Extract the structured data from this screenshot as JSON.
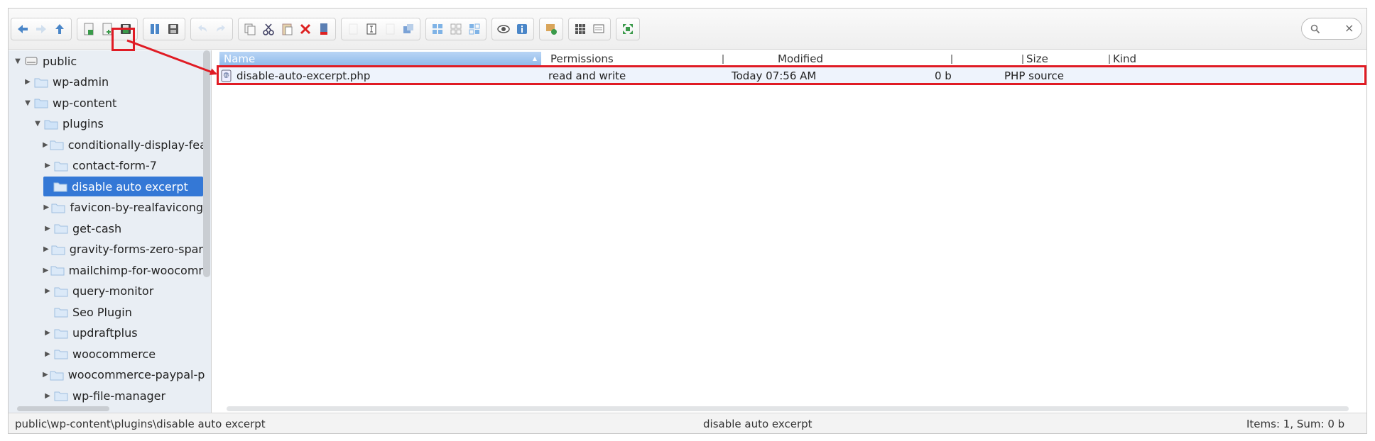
{
  "toolbar": {
    "groups": [
      {
        "buttons": [
          "back-icon",
          "forward-icon",
          "up-icon"
        ]
      },
      {
        "buttons": [
          "new-folder-icon",
          "new-file-icon",
          "save-icon"
        ]
      },
      {
        "buttons": [
          "open-icon",
          "download-icon"
        ]
      },
      {
        "buttons": [
          "undo-icon",
          "redo-icon"
        ]
      },
      {
        "buttons": [
          "copy-icon",
          "cut-icon",
          "paste-icon",
          "delete-icon",
          "empty-icon"
        ]
      },
      {
        "buttons": [
          "duplicate-icon",
          "rename-icon",
          "edit-icon",
          "resize-icon"
        ]
      },
      {
        "buttons": [
          "select-all-icon",
          "select-none-icon",
          "invert-icon"
        ]
      },
      {
        "buttons": [
          "preview-icon",
          "info-icon"
        ]
      },
      {
        "buttons": [
          "extract-icon"
        ]
      },
      {
        "buttons": [
          "icons-view-icon",
          "list-view-icon"
        ]
      },
      {
        "buttons": [
          "fullscreen-icon"
        ]
      }
    ],
    "search_clear": "×"
  },
  "tree": {
    "items": [
      {
        "label": "public",
        "level": 0,
        "expanded": true,
        "type": "drive"
      },
      {
        "label": "wp-admin",
        "level": 1,
        "expanded": false
      },
      {
        "label": "wp-content",
        "level": 1,
        "expanded": true
      },
      {
        "label": "plugins",
        "level": 2,
        "expanded": true
      },
      {
        "label": "conditionally-display-fea",
        "level": 3,
        "expanded": false
      },
      {
        "label": "contact-form-7",
        "level": 3,
        "expanded": false
      },
      {
        "label": "disable auto excerpt",
        "level": 3,
        "selected": true
      },
      {
        "label": "favicon-by-realfavicong",
        "level": 3,
        "expanded": false
      },
      {
        "label": "get-cash",
        "level": 3,
        "expanded": false
      },
      {
        "label": "gravity-forms-zero-spar",
        "level": 3,
        "expanded": false
      },
      {
        "label": "mailchimp-for-woocomr",
        "level": 3,
        "expanded": false
      },
      {
        "label": "query-monitor",
        "level": 3,
        "expanded": false
      },
      {
        "label": "Seo Plugin",
        "level": 3,
        "noarrow": true
      },
      {
        "label": "updraftplus",
        "level": 3,
        "expanded": false
      },
      {
        "label": "woocommerce",
        "level": 3,
        "expanded": false
      },
      {
        "label": "woocommerce-paypal-p",
        "level": 3,
        "expanded": false
      },
      {
        "label": "wp-file-manager",
        "level": 3,
        "expanded": false
      }
    ]
  },
  "list": {
    "columns": [
      "Name",
      "Permissions",
      "Modified",
      "Size",
      "Kind"
    ],
    "rows": [
      {
        "name": "disable-auto-excerpt.php",
        "permissions": "read and write",
        "modified": "Today 07:56 AM",
        "size": "0 b",
        "kind": "PHP source"
      }
    ]
  },
  "status": {
    "path": "public\\wp-content\\plugins\\disable auto excerpt",
    "current": "disable auto excerpt",
    "summary": "Items: 1, Sum: 0 b"
  },
  "colors": {
    "accent": "#3478d6",
    "highlight": "#e01b24"
  }
}
